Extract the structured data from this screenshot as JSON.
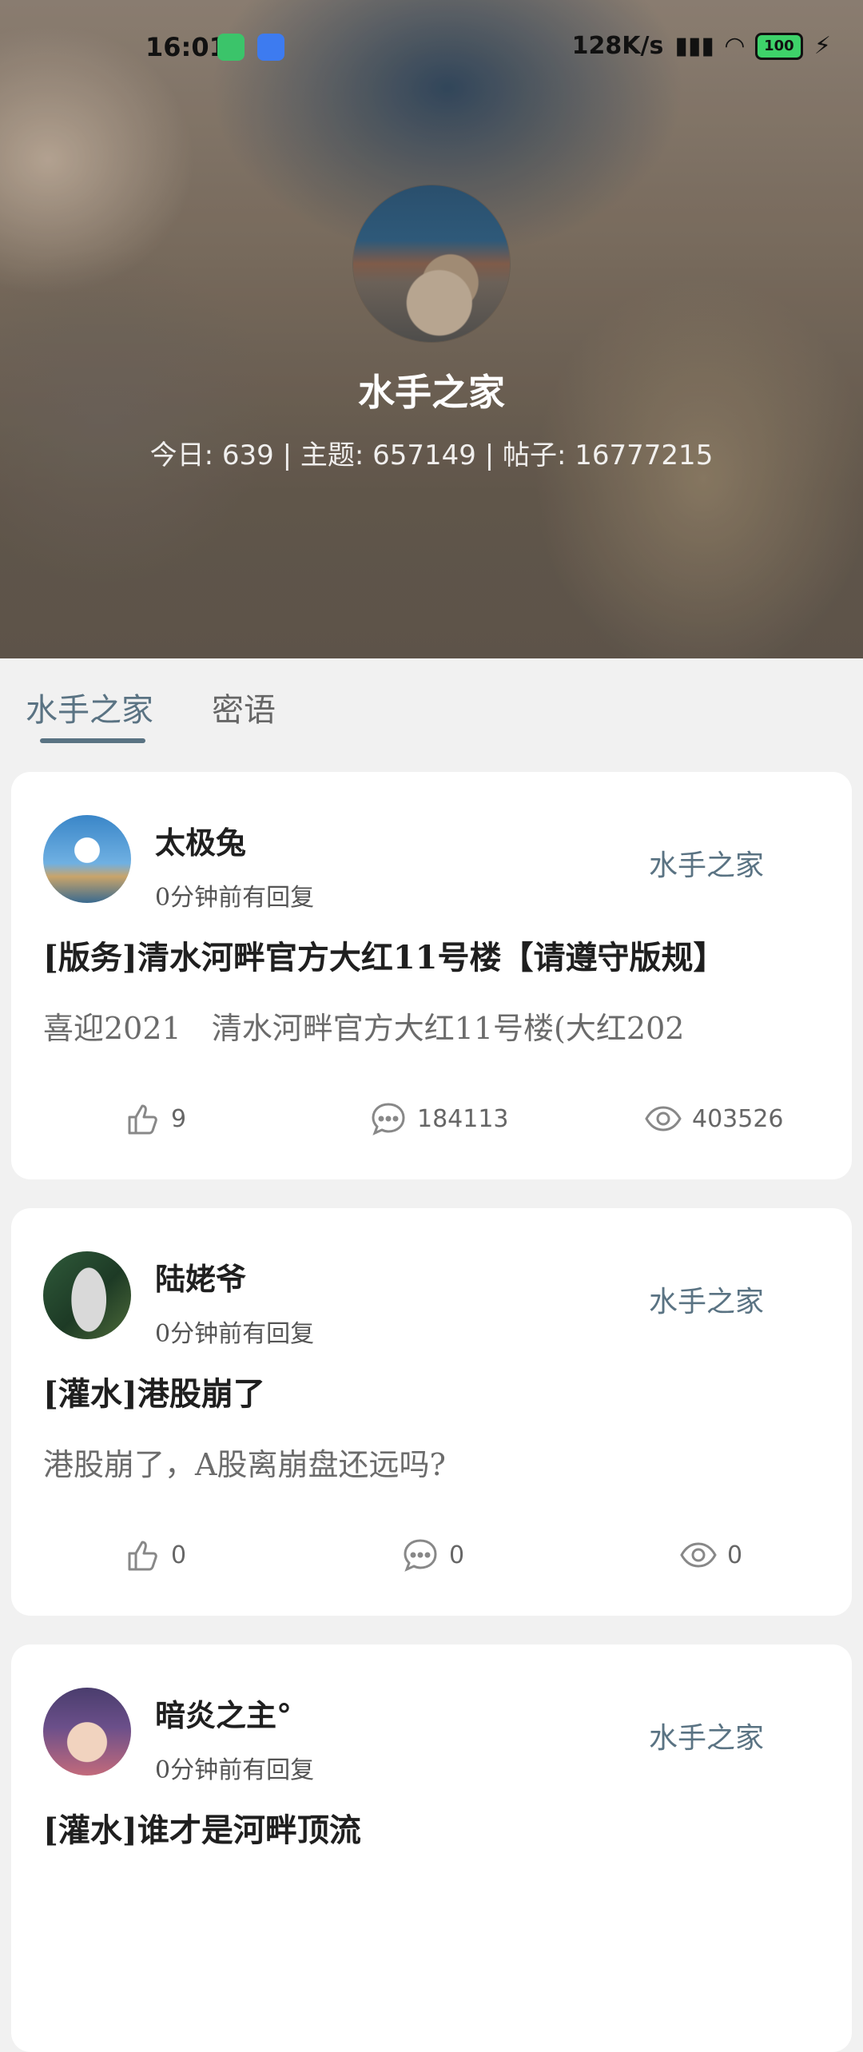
{
  "status_bar": {
    "time": "16:01",
    "network_speed": "128K/s",
    "battery": "100"
  },
  "forum": {
    "name": "水手之家",
    "stats": "今日: 639 | 主题: 657149 | 帖子: 16777215"
  },
  "tabs": [
    {
      "label": "水手之家",
      "active": true
    },
    {
      "label": "密语",
      "active": false
    }
  ],
  "posts": [
    {
      "author": "太极兔",
      "time": "0分钟前有回复",
      "board": "水手之家",
      "title": "[版务]清水河畔官方大红11号楼【请遵守版规】",
      "snippet": "喜迎2021　清水河畔官方大红11号楼(大红202",
      "likes": "9",
      "comments": "184113",
      "views": "403526"
    },
    {
      "author": "陆姥爷",
      "time": "0分钟前有回复",
      "board": "水手之家",
      "title": "[灌水]港股崩了",
      "snippet": "港股崩了，A股离崩盘还远吗?",
      "likes": "0",
      "comments": "0",
      "views": "0"
    },
    {
      "author": "暗炎之主°",
      "time": "0分钟前有回复",
      "board": "水手之家",
      "title": "[灌水]谁才是河畔顶流",
      "snippet": "",
      "likes": "",
      "comments": "",
      "views": ""
    }
  ],
  "colors": {
    "accent": "#5a7383",
    "background": "#f1f1f1",
    "card": "#ffffff"
  },
  "icons": [
    "thumb-up-icon",
    "comment-icon",
    "eye-icon",
    "wechat-icon",
    "android-icon",
    "battery-icon"
  ]
}
